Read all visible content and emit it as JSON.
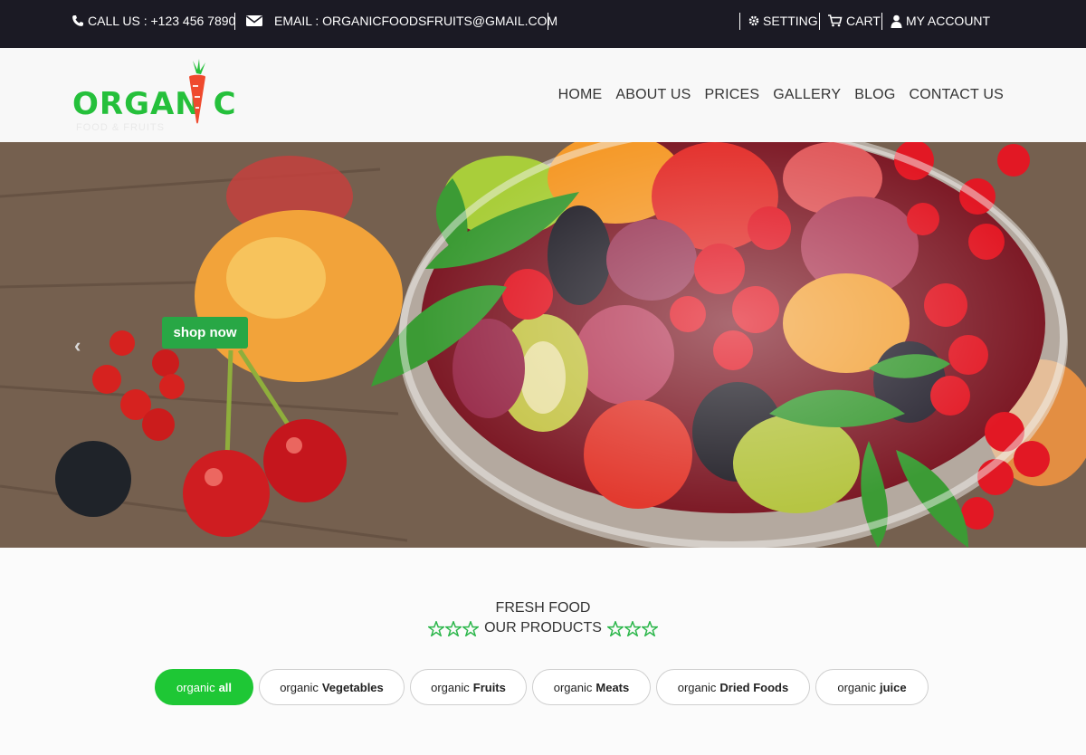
{
  "topbar": {
    "call": "CALL US : +123 456 7890",
    "email": "EMAIL : ORGANICFOODSFRUITS@GMAIL.COM",
    "setting": "SETTING",
    "cart": "CART",
    "account": "MY ACCOUNT"
  },
  "logo": {
    "text": "ORGAN C",
    "subtitle": "FOOD & FRUITS"
  },
  "nav": [
    "HOME",
    "ABOUT US",
    "PRICES",
    "GALLERY",
    "BLOG",
    "CONTACT US"
  ],
  "hero": {
    "button": "shop now",
    "prev_arrow": "‹"
  },
  "products": {
    "eyebrow": "FRESH FOOD",
    "title": "OUR PRODUCTS",
    "tabs": [
      {
        "prefix": "organic",
        "name": "all",
        "active": true
      },
      {
        "prefix": "organic",
        "name": "Vegetables",
        "active": false
      },
      {
        "prefix": "organic",
        "name": "Fruits",
        "active": false
      },
      {
        "prefix": "organic",
        "name": "Meats",
        "active": false
      },
      {
        "prefix": "organic",
        "name": "Dried Foods",
        "active": false
      },
      {
        "prefix": "organic",
        "name": "juice",
        "active": false
      }
    ]
  },
  "colors": {
    "topbar_bg": "#1b1a24",
    "brand_green": "#25c03b",
    "button_green": "#28a745",
    "tab_active": "#1ec735"
  },
  "icons": [
    "phone-icon",
    "envelope-icon",
    "gear-icon",
    "cart-icon",
    "user-icon",
    "star-icon",
    "carrot-icon"
  ]
}
